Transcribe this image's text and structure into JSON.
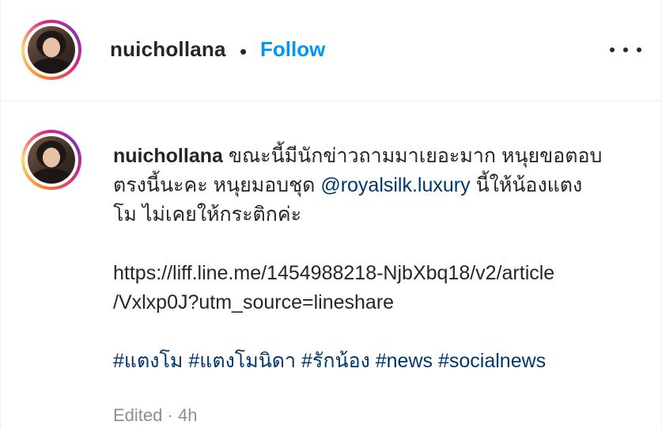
{
  "header": {
    "username": "nuichollana",
    "separator": "•",
    "follow_label": "Follow",
    "more_icon": "more-horizontal-icon"
  },
  "caption": {
    "username": "nuichollana",
    "text_line1": "ขณะนี้มีนักข่าวถามมาเยอะมาก หนุยขอตอบ",
    "text_line2a": "ตรงนี้นะคะ หนุยมอบชุด ",
    "mention": "@royalsilk.luxury",
    "text_line2b": " นี้ให้น้องแตง",
    "text_line3": "โม ไม่เคยให้กระติกค่ะ",
    "link_line1": "https://liff.line.me/1454988218-NjbXbq18/v2/article",
    "link_line2": "/Vxlxp0J?utm_source=lineshare",
    "hashtags": [
      "#แตงโม",
      "#แตงโมนิดา",
      "#รักน้อง",
      "#news",
      "#socialnews"
    ]
  },
  "meta": {
    "edited": "Edited",
    "dot": "·",
    "time": "4h"
  },
  "colors": {
    "follow": "#0095f6",
    "link": "#00376b",
    "muted": "#8e8e8e",
    "text": "#262626"
  }
}
